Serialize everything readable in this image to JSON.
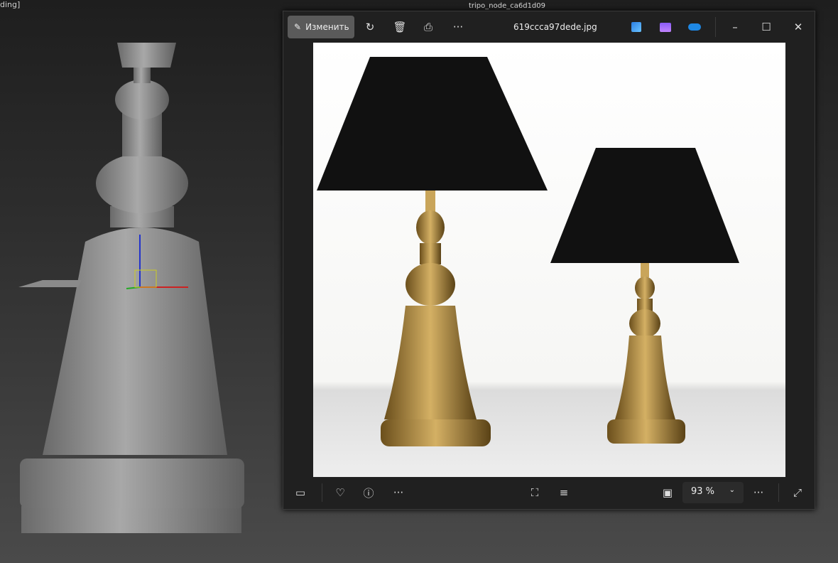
{
  "viewport": {
    "label": "ding]",
    "window_title": "tripo_node_ca6d1d09"
  },
  "viewer": {
    "toolbar": {
      "edit_label": "Изменить",
      "icons": [
        "edit-icon",
        "rotate-icon",
        "delete-icon",
        "print-icon",
        "more-icon"
      ],
      "filename": "619ccca97dede.jpg",
      "apps": [
        "photos-editor-icon",
        "clipchamp-icon",
        "onedrive-icon"
      ]
    },
    "bottom": {
      "zoom": "93 %",
      "icons": [
        "filmstrip-icon",
        "favorite-icon",
        "info-icon",
        "more-icon",
        "scan-icon",
        "text-recognition-icon",
        "actual-size-icon",
        "fullscreen-icon"
      ]
    },
    "colors": {
      "accent_onedrive": "#1e88e5",
      "shade": "#111111",
      "gold": "#b08a3a"
    }
  }
}
